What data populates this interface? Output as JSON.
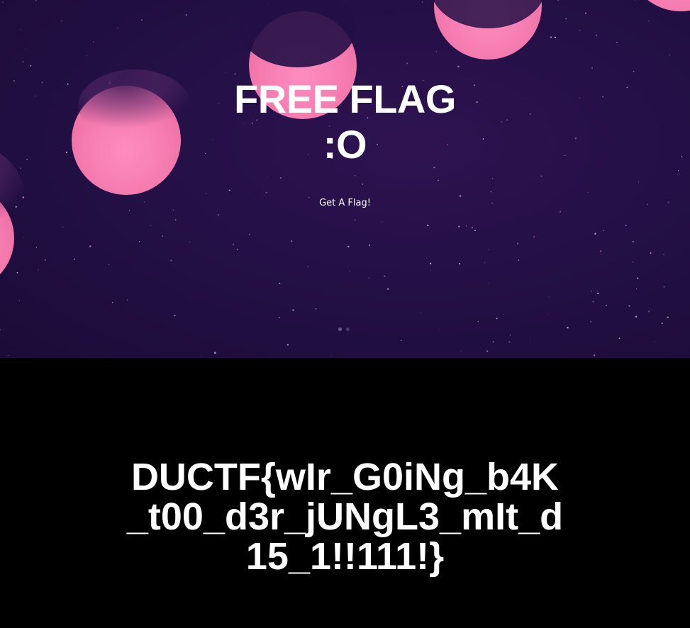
{
  "hero": {
    "title_line1": "FREE FLAG",
    "title_line2": ":O",
    "cta_label": "Get A Flag!",
    "background_color": "#241046",
    "moon_color": "#ff7fb0",
    "carousel": {
      "slides": 2,
      "active": 1
    }
  },
  "flag": {
    "line1": "DUCTF{wIr_G0iNg_b4K",
    "line2": "_t00_d3r_jUNgL3_mIt_d",
    "line3": "15_1!!111!}"
  }
}
